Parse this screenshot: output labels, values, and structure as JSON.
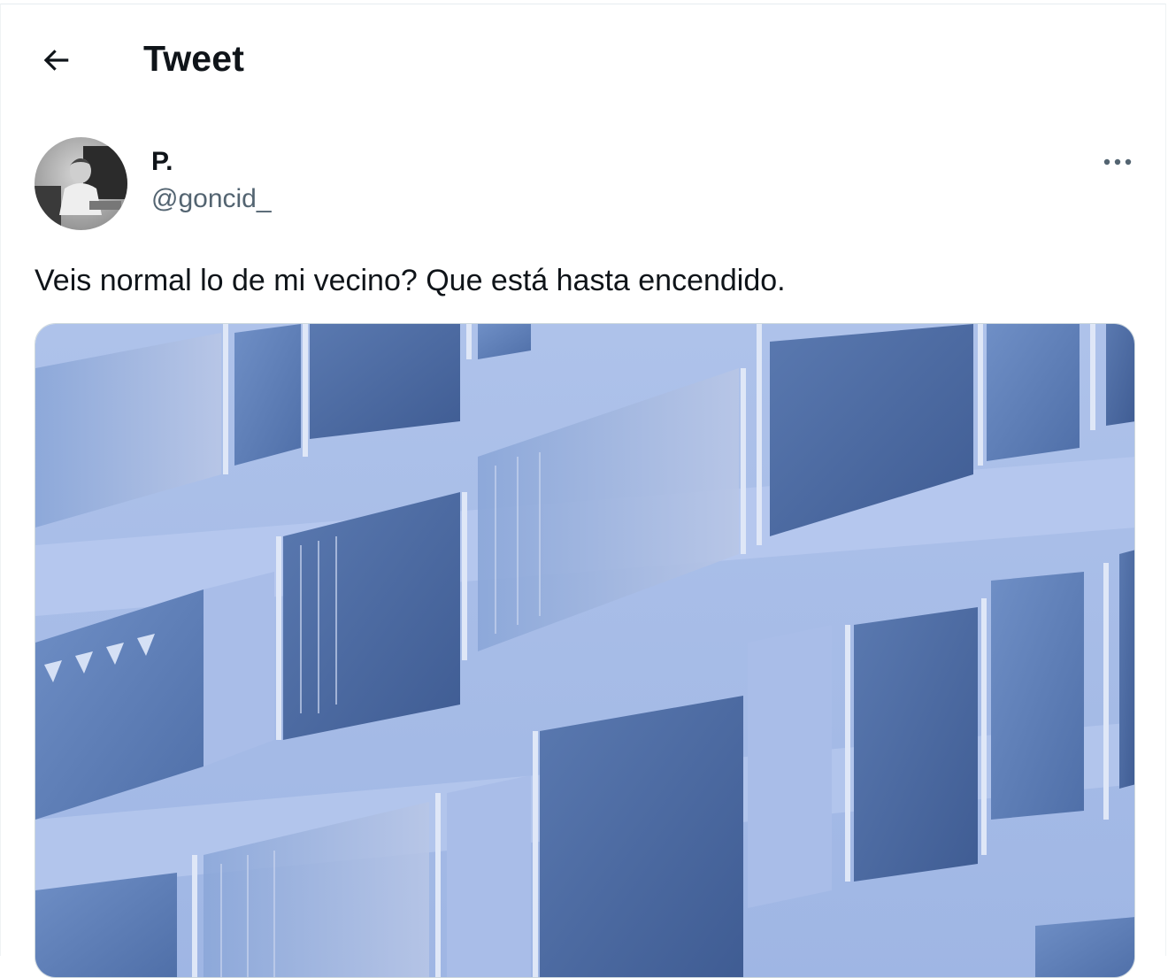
{
  "header": {
    "title": "Tweet",
    "back_icon": "arrow-left-icon"
  },
  "tweet": {
    "author": {
      "display_name": "P.",
      "handle": "@goncid_"
    },
    "more_icon": "more-horizontal-icon",
    "text": "Veis normal lo de mi vecino? Que está hasta encendido.",
    "media": {
      "kind": "photo"
    }
  },
  "colors": {
    "text_primary": "#0f1419",
    "text_secondary": "#536471",
    "border": "#cfd9de"
  }
}
